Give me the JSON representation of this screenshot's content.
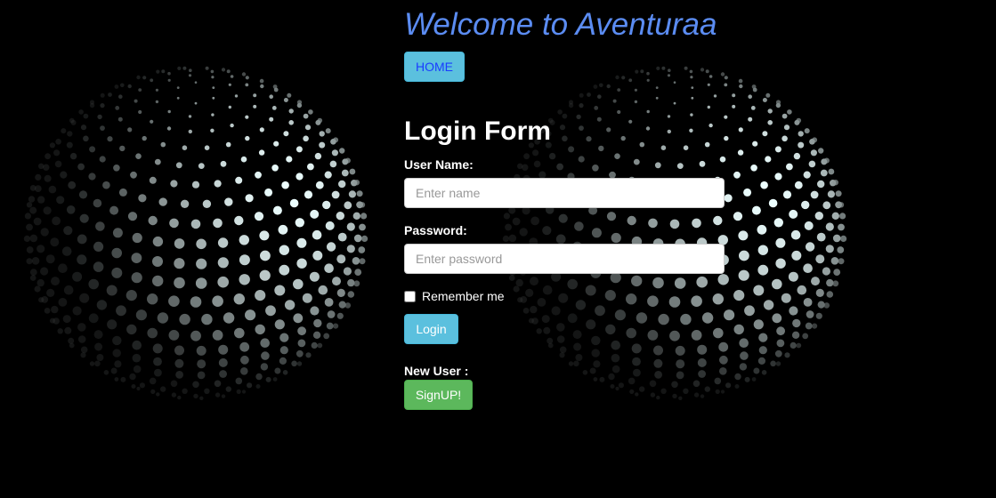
{
  "header": {
    "welcome_title": "Welcome to Aventuraa",
    "home_label": "HOME"
  },
  "form": {
    "title": "Login Form",
    "username_label": "User Name:",
    "username_placeholder": "Enter name",
    "username_value": "",
    "password_label": "Password:",
    "password_placeholder": "Enter password",
    "password_value": "",
    "remember_label": "Remember me",
    "remember_checked": false,
    "login_label": "Login",
    "new_user_label": "New User :",
    "signup_label": "SignUP!"
  },
  "colors": {
    "background": "#000000",
    "title_blue": "#5b8cf2",
    "info_button": "#5bc0de",
    "success_button": "#5cb85c",
    "home_text": "#1a3cff"
  },
  "decor": {
    "left_graphic": "dot-sphere",
    "right_graphic": "dot-sphere"
  }
}
